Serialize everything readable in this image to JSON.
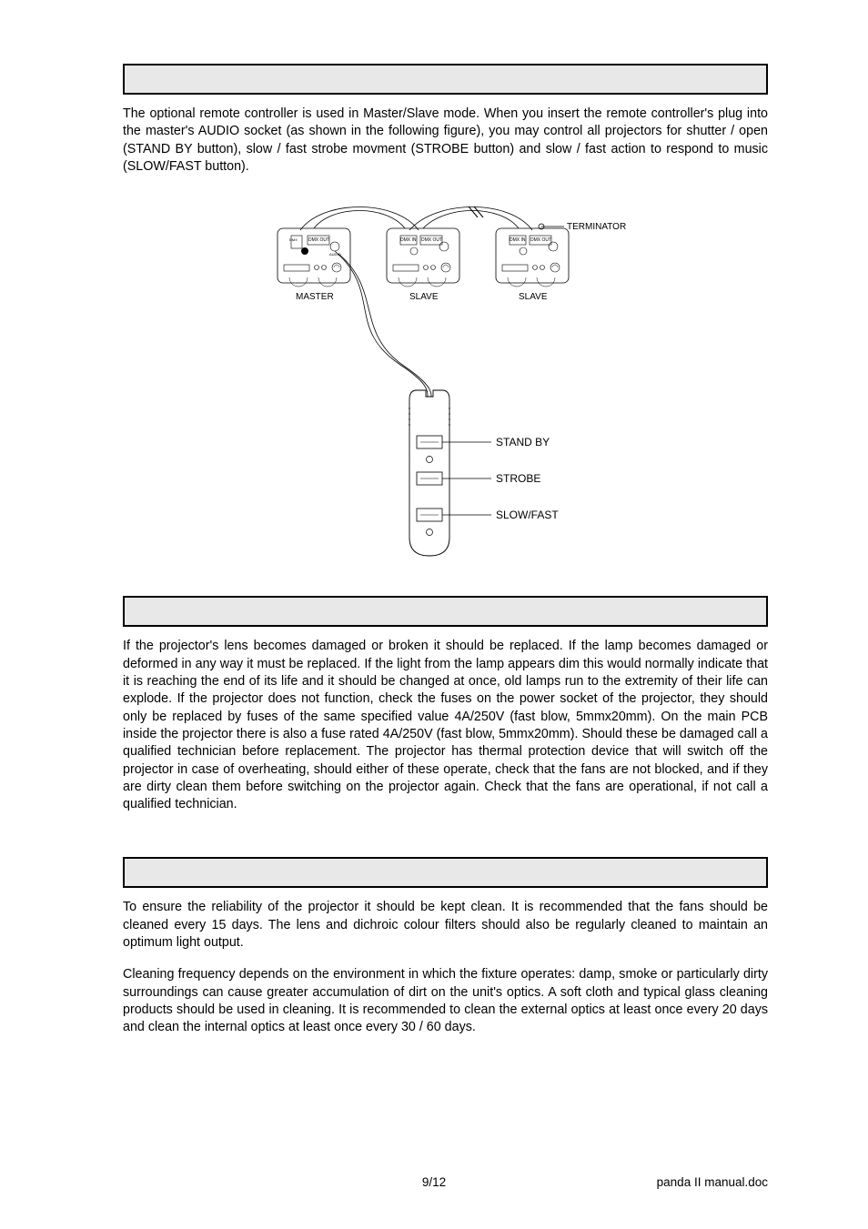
{
  "paragraphs": {
    "remote_intro": "The optional remote controller is used in Master/Slave mode. When you insert the remote controller's plug into the master's AUDIO socket (as shown in the following figure), you may control all projectors for shutter / open (STAND BY button), slow / fast strobe movment (STROBE button) and slow / fast action to respond to music (SLOW/FAST button).",
    "repair_body": "If the projector's lens becomes damaged or broken it should be replaced. If the lamp becomes damaged or deformed in any way it must be replaced. If the light from the lamp appears dim this would normally indicate that it is reaching the end of its life and it should be changed at once, old lamps run to the extremity  of their life can explode. If the projector does not function, check the fuses on the power socket of the projector, they should only be replaced by fuses of the same specified value 4A/250V (fast blow, 5mmx20mm). On the main PCB inside the projector there is also a fuse rated 4A/250V (fast blow, 5mmx20mm). Should these be damaged call a qualified technician before replacement. The projector has thermal protection device that will switch off the projector in case of overheating, should either of these operate, check that the fans are not blocked, and if they are dirty clean them before switching on the projector again. Check that the fans are operational, if not call a qualified technician.",
    "maint_p1": "To ensure the reliability of the projector it should be kept clean. It is recommended that the fans should be cleaned every 15 days. The lens and dichroic colour filters should also be regularly cleaned to maintain an optimum light output.",
    "maint_p2": "Cleaning frequency depends on the environment in which the fixture operates: damp, smoke or particularly dirty surroundings can cause greater accumulation of dirt on the unit's optics. A soft cloth and typical glass cleaning products should be used in cleaning. It is recommended to clean the external optics at least once every 20 days and clean the internal optics at least once every 30 / 60 days."
  },
  "diagram": {
    "devices": [
      {
        "label": "MASTER",
        "port_left": "DMX",
        "port_right": "DMX OUT",
        "port_right_sub": "AUDIO"
      },
      {
        "label": "SLAVE",
        "port_left": "DMX IN",
        "port_right": "DMX OUT",
        "port_right_sub": ""
      },
      {
        "label": "SLAVE",
        "port_left": "DMX IN",
        "port_right": "DMX OUT",
        "port_right_sub": ""
      }
    ],
    "terminator_label": "TERMINATOR",
    "remote_buttons": [
      "STAND BY",
      "STROBE",
      "SLOW/FAST"
    ]
  },
  "footer": {
    "page": "9/12",
    "doc": "panda II  manual.doc"
  }
}
